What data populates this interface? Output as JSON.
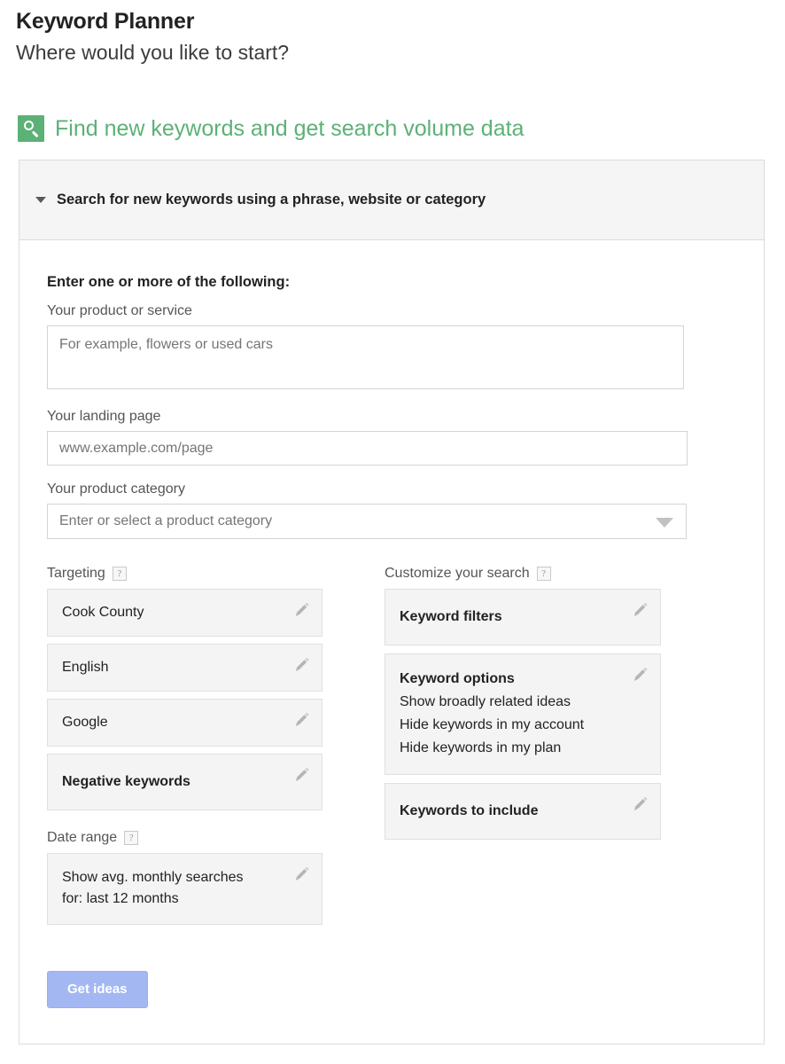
{
  "page": {
    "title": "Keyword Planner",
    "subtitle": "Where would you like to start?"
  },
  "section_link": {
    "icon": "search-icon",
    "label": "Find new keywords and get search volume data",
    "color": "#5cb176"
  },
  "card": {
    "header": {
      "caret_icon": "chevron-down-icon",
      "label": "Search for new keywords using a phrase, website or category",
      "expanded": true
    },
    "legend": "Enter one or more of the following:",
    "fields": {
      "product_or_service": {
        "label": "Your product or service",
        "placeholder": "For example, flowers or used cars",
        "value": ""
      },
      "landing_page": {
        "label": "Your landing page",
        "placeholder": "www.example.com/page",
        "value": ""
      },
      "product_category": {
        "label": "Your product category",
        "placeholder": "Enter or select a product category",
        "value": "",
        "caret_icon": "dropdown-caret-icon"
      }
    },
    "targeting": {
      "heading": "Targeting",
      "help": "?",
      "items": [
        {
          "label": "Cook County",
          "bold": false,
          "edit_icon": "pencil-icon"
        },
        {
          "label": "English",
          "bold": false,
          "edit_icon": "pencil-icon"
        },
        {
          "label": "Google",
          "bold": false,
          "edit_icon": "pencil-icon"
        },
        {
          "label": "Negative keywords",
          "bold": true,
          "edit_icon": "pencil-icon"
        }
      ]
    },
    "date_range": {
      "heading": "Date range",
      "help": "?",
      "line1": "Show avg. monthly searches",
      "line2": "for: last 12 months",
      "edit_icon": "pencil-icon"
    },
    "customize": {
      "heading": "Customize your search",
      "help": "?",
      "keyword_filters": {
        "title": "Keyword filters",
        "edit_icon": "pencil-icon"
      },
      "keyword_options": {
        "title": "Keyword options",
        "edit_icon": "pencil-icon",
        "options": [
          "Show broadly related ideas",
          "Hide keywords in my account",
          "Hide keywords in my plan"
        ]
      },
      "keywords_to_include": {
        "title": "Keywords to include",
        "edit_icon": "pencil-icon"
      }
    },
    "submit": {
      "label": "Get ideas",
      "color": "#a3b8f2"
    }
  }
}
